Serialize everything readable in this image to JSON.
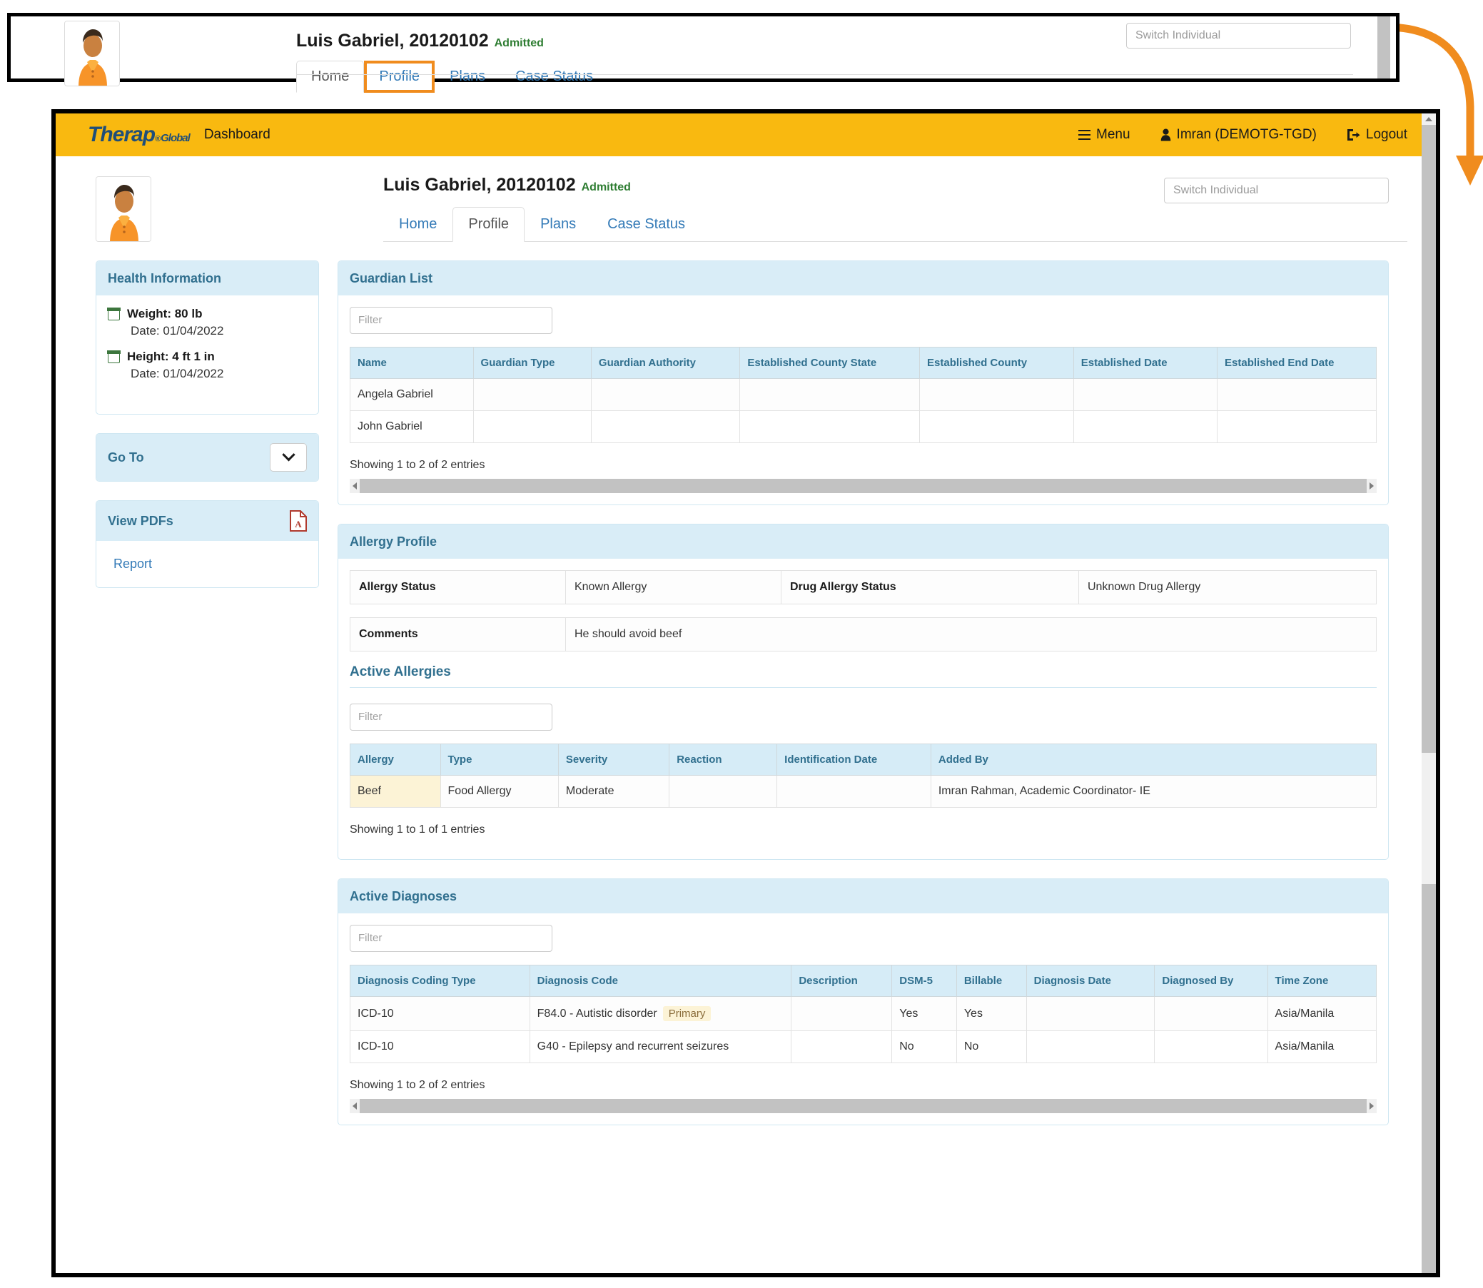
{
  "callout": {
    "individual_title": "Luis Gabriel, 20120102",
    "admitted_label": "Admitted",
    "tabs": [
      "Home",
      "Profile",
      "Plans",
      "Case Status"
    ],
    "active_tab": "Profile",
    "switch_individual_placeholder": "Switch Individual",
    "highlight_color": "#f08c1e"
  },
  "topbar": {
    "logo_main": "Therap",
    "logo_reg": "®",
    "logo_sub": "Global",
    "dashboard_label": "Dashboard",
    "menu_label": "Menu",
    "user_label": "Imran (DEMOTG-TGD)",
    "logout_label": "Logout",
    "background": "#f9b910"
  },
  "header": {
    "individual_title": "Luis Gabriel, 20120102",
    "admitted_label": "Admitted",
    "switch_individual_placeholder": "Switch Individual",
    "tabs": [
      "Home",
      "Profile",
      "Plans",
      "Case Status"
    ],
    "active_tab": "Profile"
  },
  "sidebar": {
    "health_information": {
      "title": "Health Information",
      "items": [
        {
          "label": "Weight: 80 lb",
          "date": "Date: 01/04/2022"
        },
        {
          "label": "Height: 4 ft 1 in",
          "date": "Date: 01/04/2022"
        }
      ]
    },
    "go_to": {
      "title": "Go To"
    },
    "view_pdfs": {
      "title": "View PDFs",
      "links": [
        "Report"
      ]
    }
  },
  "guardian_list": {
    "title": "Guardian List",
    "filter_placeholder": "Filter",
    "columns": [
      "Name",
      "Guardian Type",
      "Guardian Authority",
      "Established County State",
      "Established County",
      "Established Date",
      "Established End Date"
    ],
    "rows": [
      {
        "name": "Angela Gabriel",
        "guardian_type": "",
        "guardian_authority": "",
        "established_county_state": "",
        "established_county": "",
        "established_date": "",
        "established_end_date": ""
      },
      {
        "name": "John Gabriel",
        "guardian_type": "",
        "guardian_authority": "",
        "established_county_state": "",
        "established_county": "",
        "established_date": "",
        "established_end_date": ""
      }
    ],
    "showing": "Showing 1 to 2 of 2 entries"
  },
  "allergy_profile": {
    "title": "Allergy Profile",
    "allergy_status_label": "Allergy Status",
    "allergy_status_value": "Known Allergy",
    "drug_allergy_status_label": "Drug Allergy Status",
    "drug_allergy_status_value": "Unknown Drug Allergy",
    "comments_label": "Comments",
    "comments_value": "He should avoid beef",
    "active_allergies": {
      "title": "Active Allergies",
      "filter_placeholder": "Filter",
      "columns": [
        "Allergy",
        "Type",
        "Severity",
        "Reaction",
        "Identification Date",
        "Added By"
      ],
      "rows": [
        {
          "allergy": "Beef",
          "type": "Food Allergy",
          "severity": "Moderate",
          "reaction": "",
          "identification_date": "",
          "added_by": "Imran Rahman, Academic Coordinator- IE"
        }
      ],
      "showing": "Showing 1 to 1 of 1 entries"
    }
  },
  "active_diagnoses": {
    "title": "Active Diagnoses",
    "filter_placeholder": "Filter",
    "columns": [
      "Diagnosis Coding Type",
      "Diagnosis Code",
      "Description",
      "DSM-5",
      "Billable",
      "Diagnosis Date",
      "Diagnosed By",
      "Time Zone"
    ],
    "rows": [
      {
        "coding_type": "ICD-10",
        "code": "F84.0 - Autistic disorder",
        "badge": "Primary",
        "description": "",
        "dsm5": "Yes",
        "billable": "Yes",
        "diagnosis_date": "",
        "diagnosed_by": "",
        "time_zone": "Asia/Manila"
      },
      {
        "coding_type": "ICD-10",
        "code": "G40 - Epilepsy and recurrent seizures",
        "badge": "",
        "description": "",
        "dsm5": "No",
        "billable": "No",
        "diagnosis_date": "",
        "diagnosed_by": "",
        "time_zone": "Asia/Manila"
      }
    ],
    "showing": "Showing 1 to 2 of 2 entries"
  }
}
